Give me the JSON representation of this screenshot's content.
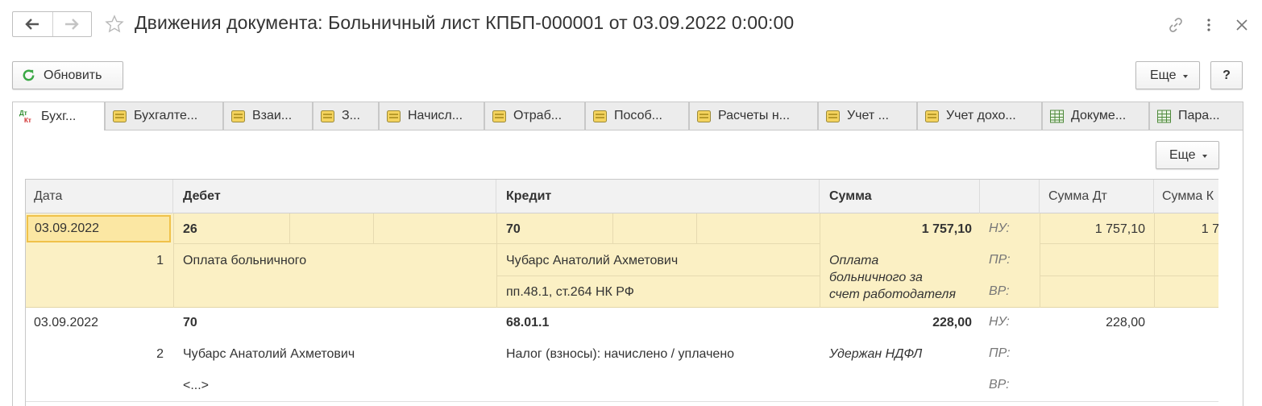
{
  "window": {
    "title": "Движения документа: Больничный лист КПБП-000001 от 03.09.2022 0:00:00"
  },
  "toolbar": {
    "refresh_label": "Обновить",
    "more_label": "Еще",
    "help_label": "?"
  },
  "tabs": [
    {
      "label": "Бухг...",
      "icon": "dt-kt-icon",
      "active": true
    },
    {
      "label": "Бухгалте...",
      "icon": "register-icon"
    },
    {
      "label": "Взаи...",
      "icon": "register-icon"
    },
    {
      "label": "З...",
      "icon": "register-icon"
    },
    {
      "label": "Начисл...",
      "icon": "register-icon"
    },
    {
      "label": "Отраб...",
      "icon": "register-icon"
    },
    {
      "label": "Пособ...",
      "icon": "register-icon"
    },
    {
      "label": "Расчеты н...",
      "icon": "register-icon"
    },
    {
      "label": "Учет ...",
      "icon": "register-icon"
    },
    {
      "label": "Учет дохо...",
      "icon": "register-icon"
    },
    {
      "label": "Докуме...",
      "icon": "table-icon"
    },
    {
      "label": "Пара...",
      "icon": "table-icon"
    }
  ],
  "panel": {
    "more_label": "Еще"
  },
  "table": {
    "columns": {
      "date": "Дата",
      "debit": "Дебет",
      "credit": "Кредит",
      "sum": "Сумма",
      "sum_dt": "Сумма Дт",
      "sum_kt": "Сумма К"
    },
    "labels": {
      "nu": "НУ:",
      "pr": "ПР:",
      "vr": "ВР:"
    },
    "rows": [
      {
        "date": "03.09.2022",
        "number": "1",
        "debit_account": "26",
        "debit_sub1": "Оплата больничного",
        "debit_sub2": "",
        "credit_account": "70",
        "credit_sub1": "Чубарс Анатолий Ахметович",
        "credit_sub2": "пп.48.1, ст.264 НК РФ",
        "sum": "1 757,10",
        "content_line1": "Оплата",
        "content_line2": "больничного за",
        "content_line3": "счет работодателя",
        "sum_dt_nu": "1 757,10",
        "sum_kt_nu": "1 7"
      },
      {
        "date": "03.09.2022",
        "number": "2",
        "debit_account": "70",
        "debit_sub1": "Чубарс Анатолий Ахметович",
        "debit_sub2": "<...>",
        "credit_account": "68.01.1",
        "credit_sub1": "Налог (взносы): начислено / уплачено",
        "credit_sub2": "",
        "sum": "228,00",
        "content_line1": "Удержан НДФЛ",
        "sum_dt_nu": "228,00",
        "sum_kt_nu": ""
      }
    ]
  },
  "colors": {
    "selected_row": "#fbf0c4",
    "selected_cell_border": "#f0c24a",
    "refresh_icon": "#3aa845"
  }
}
